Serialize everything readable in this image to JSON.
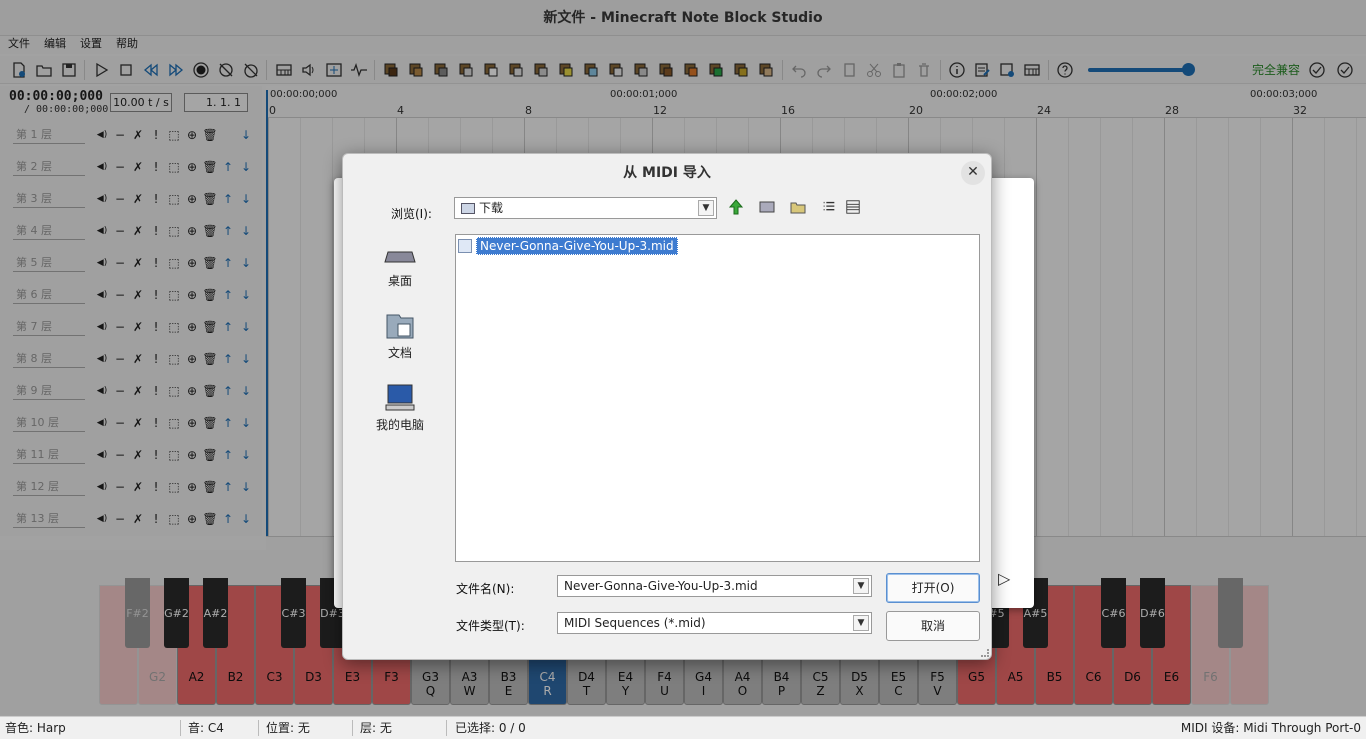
{
  "window": {
    "title": "新文件 - Minecraft Note Block Studio"
  },
  "menu": [
    "文件",
    "编辑",
    "设置",
    "帮助"
  ],
  "toolbar": {
    "compat_label": "完全兼容"
  },
  "time": {
    "current": "00:00:00;000",
    "total": "/ 00:00:00;000",
    "tempo": "10.00 t / s",
    "position": "1. 1. 1"
  },
  "layers": [
    "第 1 层",
    "第 2 层",
    "第 3 层",
    "第 4 层",
    "第 5 层",
    "第 6 层",
    "第 7 层",
    "第 8 层",
    "第 9 层",
    "第 10 层",
    "第 11 层",
    "第 12 层",
    "第 13 层"
  ],
  "ruler": {
    "ticks": [
      "0",
      "4",
      "8",
      "12",
      "16",
      "20",
      "24",
      "28",
      "32"
    ],
    "times": [
      "00:00:00;000",
      "00:00:01;000",
      "00:00:02;000",
      "00:00:03;000"
    ]
  },
  "piano": {
    "white_keys": [
      {
        "note": "",
        "key": ""
      },
      {
        "note": "G2",
        "key": ""
      },
      {
        "note": "A2",
        "key": ""
      },
      {
        "note": "B2",
        "key": ""
      },
      {
        "note": "C3",
        "key": ""
      },
      {
        "note": "D3",
        "key": ""
      },
      {
        "note": "E3",
        "key": ""
      },
      {
        "note": "F3",
        "key": ""
      },
      {
        "note": "G3",
        "key": "Q"
      },
      {
        "note": "A3",
        "key": "W"
      },
      {
        "note": "B3",
        "key": "E"
      },
      {
        "note": "C4",
        "key": "R"
      },
      {
        "note": "D4",
        "key": "T"
      },
      {
        "note": "E4",
        "key": "Y"
      },
      {
        "note": "F4",
        "key": "U"
      },
      {
        "note": "G4",
        "key": "I"
      },
      {
        "note": "A4",
        "key": "O"
      },
      {
        "note": "B4",
        "key": "P"
      },
      {
        "note": "C5",
        "key": "Z"
      },
      {
        "note": "D5",
        "key": "X"
      },
      {
        "note": "E5",
        "key": "C"
      },
      {
        "note": "F5",
        "key": "V"
      },
      {
        "note": "G5",
        "key": ""
      },
      {
        "note": "A5",
        "key": ""
      },
      {
        "note": "B5",
        "key": ""
      },
      {
        "note": "C6",
        "key": ""
      },
      {
        "note": "D6",
        "key": ""
      },
      {
        "note": "E6",
        "key": ""
      },
      {
        "note": "F6",
        "key": ""
      },
      {
        "note": "",
        "key": ""
      }
    ],
    "black_keys": [
      "F#2",
      "G#2",
      "A#2",
      "C#3",
      "D#3",
      "#5",
      "A#5",
      "C#6",
      "D#6",
      ""
    ],
    "selected": "C4"
  },
  "status": {
    "instrument": "音色: Harp",
    "note": "音: C4",
    "position": "位置: 无",
    "layer": "层: 无",
    "selected": "已选择: 0 / 0",
    "midi_device": "MIDI 设备: Midi Through Port-0"
  },
  "dialog": {
    "title": "从 MIDI 导入",
    "look_in_label": "浏览(I):",
    "look_in_value": "下载",
    "places": [
      "桌面",
      "文档",
      "我的电脑"
    ],
    "files": [
      "Never-Gonna-Give-You-Up-3.mid"
    ],
    "filename_label": "文件名(N):",
    "filename_value": "Never-Gonna-Give-You-Up-3.mid",
    "filetype_label": "文件类型(T):",
    "filetype_value": "MIDI Sequences (*.mid)",
    "open_button": "打开(O)",
    "cancel_button": "取消"
  }
}
